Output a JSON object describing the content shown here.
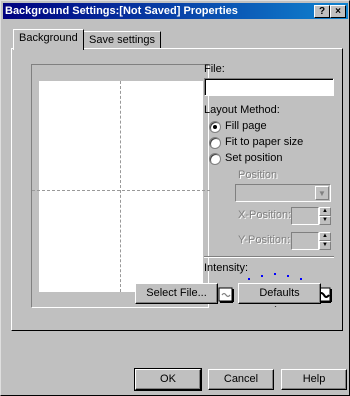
{
  "window": {
    "title": "Background Settings:[Not Saved] Properties",
    "help_button": "?",
    "close_button": "×"
  },
  "tabs": [
    {
      "label": "Background",
      "active": true
    },
    {
      "label": "Save settings",
      "active": false
    }
  ],
  "file": {
    "label": "File:",
    "value": ""
  },
  "layout": {
    "label": "Layout Method:",
    "options": [
      {
        "label": "Fill page",
        "checked": true
      },
      {
        "label": "Fit to paper size",
        "checked": false
      },
      {
        "label": "Set position",
        "checked": false
      }
    ],
    "position_label": "Position",
    "position_value": "",
    "x_label": "X-Position:",
    "y_label": "Y-Position:"
  },
  "intensity": {
    "label": "Intensity:",
    "level": 0.5
  },
  "panel_buttons": {
    "select_file": "Select File...",
    "defaults": "Defaults"
  },
  "dialog_buttons": {
    "ok": "OK",
    "cancel": "Cancel",
    "help": "Help"
  },
  "colors": {
    "titlebar_start": "#000080",
    "titlebar_end": "#1084d0",
    "face": "#c0c0c0",
    "slider_ticks": "#0000ff"
  }
}
